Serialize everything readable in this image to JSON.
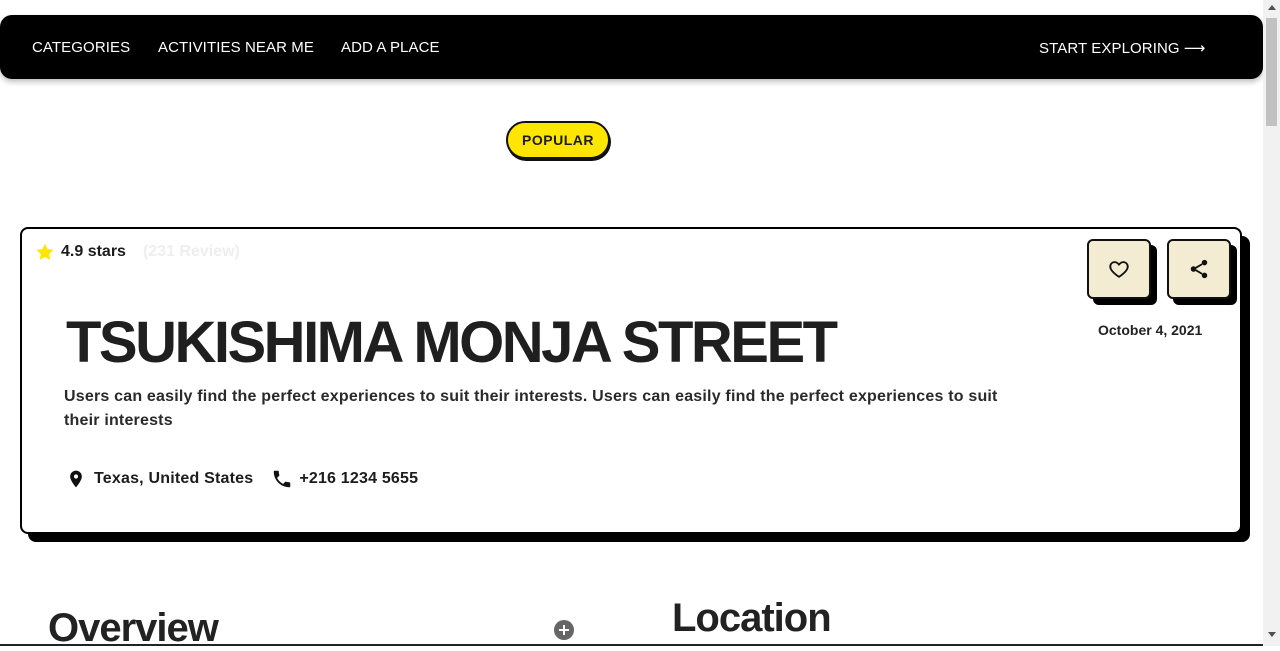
{
  "nav": {
    "links": [
      "CATEGORIES",
      "ACTIVITIES NEAR ME",
      "ADD A PLACE"
    ],
    "cta": "START EXPLORING",
    "cta_arrow": "⟶"
  },
  "badge": {
    "label": "POPULAR",
    "color": "#ffe600"
  },
  "place": {
    "rating": "4.9 stars",
    "reviews": "(231 Review)",
    "title": "TSUKISHIMA MONJA STREET",
    "description": "Users can easily find the perfect experiences to suit their interests. Users can easily find the perfect experiences to suit their interests",
    "location": "Texas, United States",
    "phone": "+216 1234 5655",
    "date": "October 4, 2021",
    "icons": [
      "star-icon",
      "location-pin-icon",
      "phone-icon",
      "heart-icon",
      "share-icon"
    ],
    "accent": "#f3ecd2"
  },
  "sections": {
    "overview": "Overview",
    "location": "Location"
  }
}
